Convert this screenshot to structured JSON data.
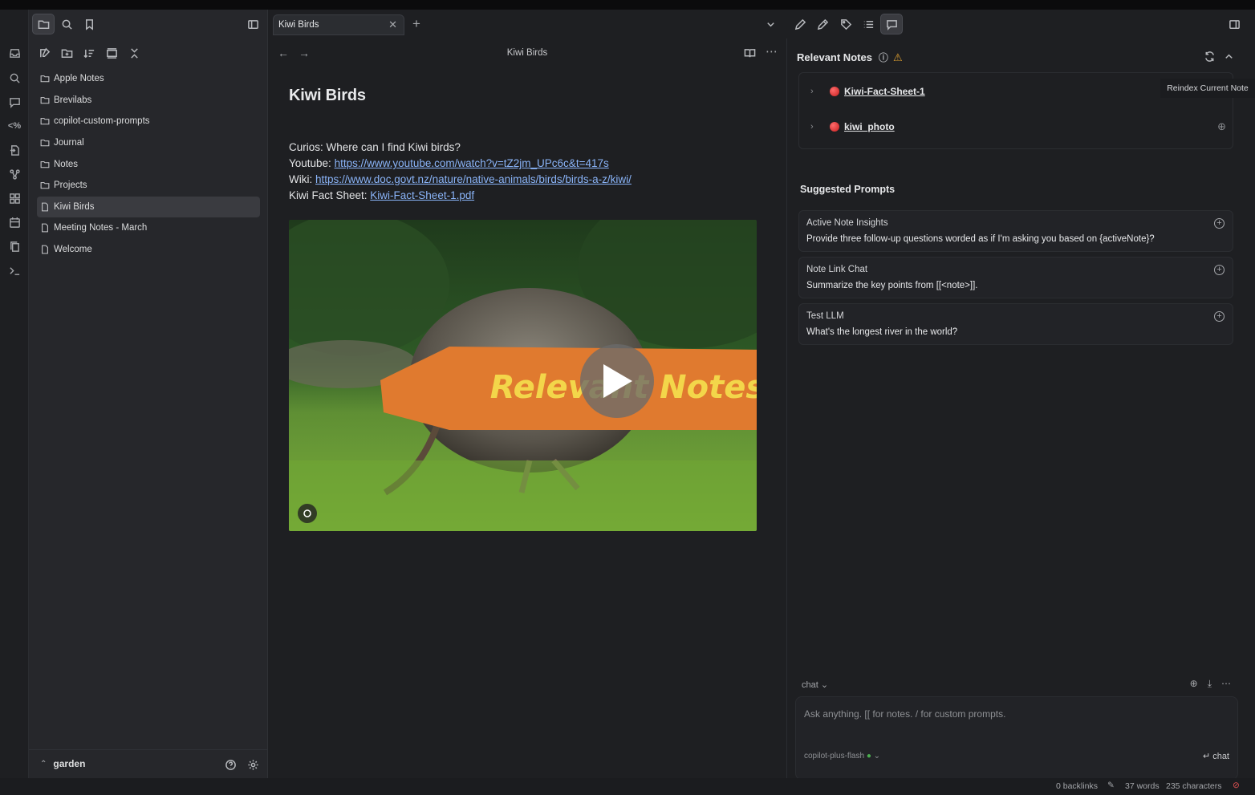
{
  "tab": {
    "title": "Kiwi Birds"
  },
  "editor": {
    "header_title": "Kiwi Birds",
    "title": "Kiwi Birds",
    "lines": {
      "q": "Curios: Where can I find Kiwi birds?",
      "yt_label": "Youtube: ",
      "yt_link": "https://www.youtube.com/watch?v=tZ2jm_UPc6c&t=417s",
      "wiki_label": "Wiki: ",
      "wiki_link": "https://www.doc.govt.nz/nature/native-animals/birds/birds-a-z/kiwi/",
      "fact_label": "Kiwi Fact Sheet: ",
      "fact_link": "Kiwi-Fact-Sheet-1.pdf"
    },
    "overlay_text": "Relevant Notes"
  },
  "sidebar": {
    "items": [
      {
        "type": "folder",
        "label": "Apple Notes"
      },
      {
        "type": "folder",
        "label": "Brevilabs"
      },
      {
        "type": "folder",
        "label": "copilot-custom-prompts"
      },
      {
        "type": "folder",
        "label": "Journal"
      },
      {
        "type": "folder",
        "label": "Notes"
      },
      {
        "type": "folder",
        "label": "Projects"
      },
      {
        "type": "file",
        "label": "Kiwi Birds"
      },
      {
        "type": "file",
        "label": "Meeting Notes - March"
      },
      {
        "type": "file",
        "label": "Welcome"
      }
    ],
    "vault": "garden"
  },
  "right": {
    "relevant_title": "Relevant Notes",
    "tooltip": "Reindex Current Note",
    "relevant": [
      {
        "label": "Kiwi-Fact-Sheet-1"
      },
      {
        "label": "kiwi_photo"
      }
    ],
    "suggested_title": "Suggested Prompts",
    "prompts": [
      {
        "title": "Active Note Insights",
        "desc": "Provide three follow-up questions worded as if I'm asking you based on {activeNote}?"
      },
      {
        "title": "Note Link Chat",
        "desc": "Summarize the key points from [[<note>]]."
      },
      {
        "title": "Test LLM",
        "desc": "What's the longest river in the world?"
      }
    ],
    "chat_mode": "chat",
    "chat_placeholder": "Ask anything. [[ for notes. / for custom prompts.",
    "model": "copilot-plus-flash",
    "send_label": "↵ chat"
  },
  "status": {
    "backlinks": "0 backlinks",
    "words": "37 words",
    "chars": "235 characters"
  },
  "colors": {
    "accent_orange": "#e07a2f",
    "overlay_text": "#f3d64a",
    "link": "#8ab4f8"
  }
}
